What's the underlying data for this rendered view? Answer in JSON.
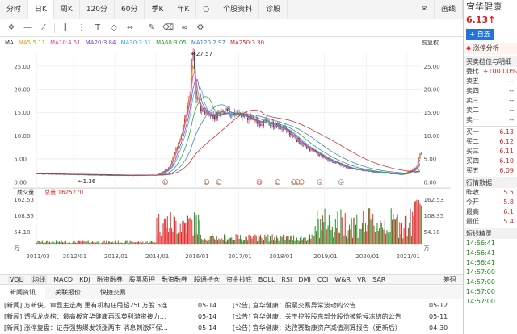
{
  "tabs": [
    "分时",
    "日K",
    "周K",
    "120分",
    "60分",
    "季K",
    "年K",
    "",
    "个股资料",
    "诊股",
    "",
    "画线"
  ],
  "tab_active": 1,
  "toolbar_icons": [
    "move-icon",
    "line-icon",
    "ray-icon",
    "parallel-icon",
    "fib-icon",
    "text-icon",
    "channel-icon",
    "measure-icon",
    "brush-icon",
    "eraser-icon",
    "link-icon",
    "settings-icon"
  ],
  "ma": {
    "label": "MA",
    "items": [
      {
        "text": "MA5:5.11",
        "color": "#d4a017"
      },
      {
        "text": "MA10:4.51",
        "color": "#e8439b"
      },
      {
        "text": "MA20:3.84",
        "color": "#7a3fd0"
      },
      {
        "text": "MA30:3.51",
        "color": "#2ab0e6"
      },
      {
        "text": "MA60:3.05",
        "color": "#2ca02c"
      },
      {
        "text": "MA120:2.97",
        "color": "#3a7fc1"
      },
      {
        "text": "MA250:3.30",
        "color": "#d62728"
      }
    ],
    "fq": "前复权"
  },
  "volume_label": "成交量",
  "volume_total": "总量:1625270",
  "xlabels": [
    "2011/03",
    "2012/01",
    "2013/01",
    "2014/01",
    "2016/01",
    "2017/01",
    "2018/01",
    "2019/01",
    "2020/01",
    "2021/01"
  ],
  "ylabels": [
    "25.00",
    "20.00",
    "15.00",
    "10.00",
    "5.00",
    "0.00"
  ],
  "vol_ylabels": [
    "162.53",
    "108.35",
    "54.18",
    "万"
  ],
  "price_high": "27.57",
  "price_low": "1.36",
  "indicators": [
    "VOL",
    "均线",
    "MACD",
    "KDJ",
    "融资融券",
    "股票质押",
    "融资融券",
    "股通持仓",
    "资金抄底",
    "BOLL",
    "RSI",
    "DMI",
    "CCI",
    "W&R",
    "VR",
    "SAR"
  ],
  "indicator_right": "筹码",
  "news_tabs": [
    "新闻资讯",
    "关联报价",
    "快捷交易"
  ],
  "news": [
    {
      "t": "[新闻] 方新侠、章显主选离 更有机构狂甩超250万股 5连...",
      "d": "05-14",
      "t2": "[公告] 宜华健康：股票交易异常波动的公告",
      "d2": "05-12"
    },
    {
      "t": "[新闻] 透视龙虎榜：最高板宜华健康再现英利游资接力...",
      "d": "05-14",
      "t2": "[公告] 宜华健康：关于控股股东部分股份被轮候冻结的公告",
      "d2": "05-11"
    },
    {
      "t": "[新闻] 涨停复盘：证券强势爆发领涨两市 消息刺激环保...",
      "d": "05-14",
      "t2": "[公告] 宜华健康：达孜赛勒康资产减值测算报告（更新后）",
      "d2": "04-30"
    }
  ],
  "side": {
    "name": "宜华健康",
    "price": "6.13",
    "arrow": "↑",
    "add": "+ 自选",
    "status": "涨停分析",
    "section": "买卖档位与明细",
    "weibi_k": "委比",
    "weibi_v": "+100.00%",
    "sells": [
      {
        "k": "卖五",
        "v": "--"
      },
      {
        "k": "卖四",
        "v": "--"
      },
      {
        "k": "卖三",
        "v": "--"
      },
      {
        "k": "卖二",
        "v": "--"
      },
      {
        "k": "卖一",
        "v": "--"
      }
    ],
    "buys": [
      {
        "k": "买一",
        "v": "6.13"
      },
      {
        "k": "买二",
        "v": "6.12"
      },
      {
        "k": "买三",
        "v": "6.11"
      },
      {
        "k": "买四",
        "v": "6.10"
      },
      {
        "k": "买五",
        "v": "6.09"
      }
    ],
    "hq_title": "行情数据",
    "hq": [
      {
        "k": "昨收",
        "v": "5.5"
      },
      {
        "k": "今开",
        "v": "5.8"
      },
      {
        "k": "最高",
        "v": "6.1"
      },
      {
        "k": "最低",
        "v": "5.4"
      }
    ],
    "trades_title": "短线精灵",
    "trades": [
      "14:56:41",
      "14:56:41",
      "14:56:41",
      "14:57:00",
      "14:57:00",
      "14:57:00",
      "14:57:00"
    ]
  },
  "colors": {
    "up": "#e02424",
    "down": "#1a8a1a",
    "candle": "#1f3f8f"
  }
}
